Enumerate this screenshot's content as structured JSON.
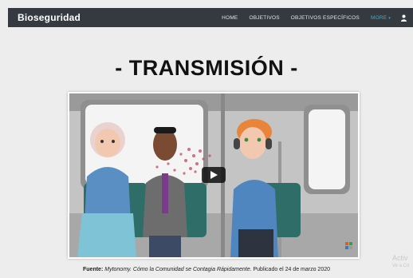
{
  "navbar": {
    "brand": "Bioseguridad",
    "items": [
      {
        "label": "HOME"
      },
      {
        "label": "OBJETIVOS"
      },
      {
        "label": "OBJETIVOS ESPECÍFICOS"
      },
      {
        "label": "MORE"
      }
    ],
    "more_caret": "▾"
  },
  "page": {
    "title": "- TRANSMISIÓN -"
  },
  "video": {
    "play_icon": "play-icon"
  },
  "caption": {
    "label": "Fuente:",
    "source": "Mytonomy. Cómo la Comunidad se Contagia Rápidamente",
    "date_text": ". Publicado el 24 de marzo 2020"
  },
  "watermark": {
    "line1": "Activ",
    "line2": "Ve a Co"
  },
  "colors": {
    "navbar_bg": "#343a40",
    "active_nav": "#34b3d9",
    "page_bg": "#ededed"
  }
}
